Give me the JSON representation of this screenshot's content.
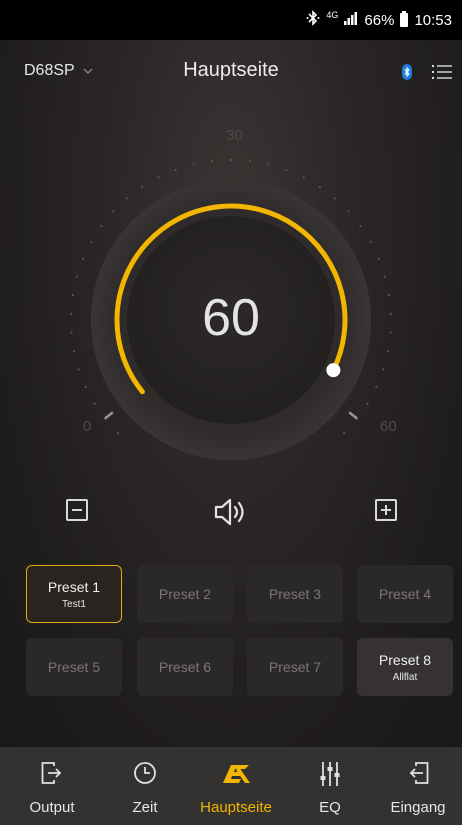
{
  "status_bar": {
    "network_label": "4G",
    "battery": "66%",
    "time": "10:53"
  },
  "header": {
    "device": "D68SP",
    "title": "Hauptseite"
  },
  "dial": {
    "value": "60",
    "scale_min": "0",
    "scale_mid": "30",
    "scale_max": "60",
    "level_fraction": 1.0,
    "accent_color": "#f2b500"
  },
  "presets": [
    {
      "name": "Preset 1",
      "sub": "Test1",
      "state": "active"
    },
    {
      "name": "Preset 2",
      "sub": "",
      "state": "idle"
    },
    {
      "name": "Preset 3",
      "sub": "",
      "state": "idle"
    },
    {
      "name": "Preset 4",
      "sub": "",
      "state": "idle"
    },
    {
      "name": "Preset 5",
      "sub": "",
      "state": "idle"
    },
    {
      "name": "Preset 6",
      "sub": "",
      "state": "idle"
    },
    {
      "name": "Preset 7",
      "sub": "",
      "state": "idle"
    },
    {
      "name": "Preset 8",
      "sub": "Allflat",
      "state": "lit"
    }
  ],
  "nav": {
    "output": "Output",
    "zeit": "Zeit",
    "hauptseite": "Hauptseite",
    "eq": "EQ",
    "eingang": "Eingang",
    "active": "hauptseite",
    "active_color": "#f2b500"
  },
  "icons": {
    "minus": "minus-square-icon",
    "plus": "plus-square-icon",
    "speaker": "speaker-icon",
    "bluetooth": "bluetooth-icon",
    "menu": "list-menu-icon"
  }
}
